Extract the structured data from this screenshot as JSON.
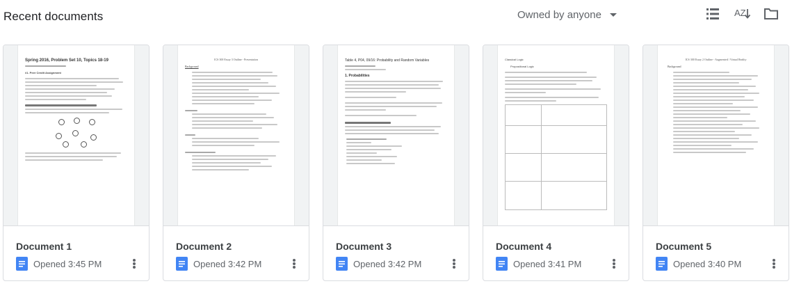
{
  "header": {
    "title": "Recent documents",
    "owner_filter": "Owned by anyone",
    "sort_label": "AZ"
  },
  "icons": {
    "list_view": "list-view-icon",
    "sort": "sort-az-icon",
    "folder": "folder-icon",
    "docs": "google-docs-icon",
    "more": "more-vert-icon"
  },
  "colors": {
    "docs_blue": "#4285f4",
    "text_primary": "#202124",
    "text_secondary": "#5f6368",
    "border": "#dadce0"
  },
  "documents": [
    {
      "name": "Document 1",
      "opened": "Opened 3:45 PM",
      "preview_title": "Spring 2016, Problem Set 10, Topics 18-19",
      "preview_subtitle": "#1. Peer Credit Assignment"
    },
    {
      "name": "Document 2",
      "opened": "Opened 3:42 PM",
      "preview_title": "ICS 300 Essay 3 Outline - Presentation",
      "preview_subtitle": "Background"
    },
    {
      "name": "Document 3",
      "opened": "Opened 3:42 PM",
      "preview_title": "Table 4, P04, 09/16: Probability and Random Variables",
      "preview_subtitle": "1. Probabilities"
    },
    {
      "name": "Document 4",
      "opened": "Opened 3:41 PM",
      "preview_title": "Classical Logic",
      "preview_subtitle": "Propositional Logic"
    },
    {
      "name": "Document 5",
      "opened": "Opened 3:40 PM",
      "preview_title": "ICS 300 Essay 2 Outline - Augmented / Virtual Reality",
      "preview_subtitle": "Background"
    }
  ]
}
